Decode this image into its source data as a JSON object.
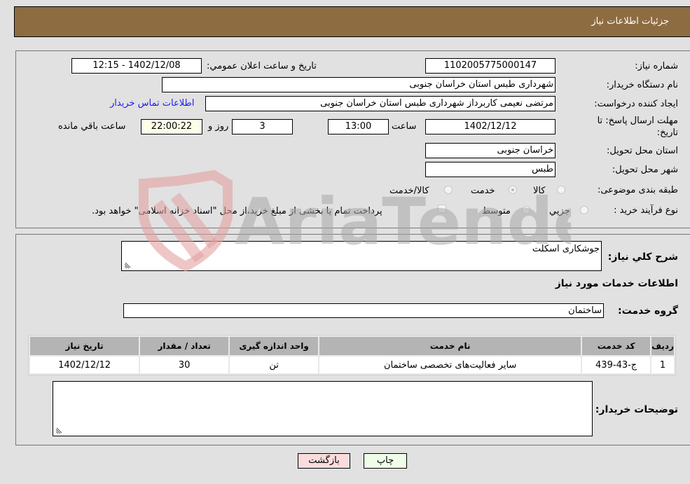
{
  "header": {
    "title": "جزئیات اطلاعات نیاز"
  },
  "details": {
    "need_number_label": "شماره نیاز:",
    "need_number": "1102005775000147",
    "announce_label": "تاریخ و ساعت اعلان عمومي:",
    "announce_value": "1402/12/08 - 12:15",
    "buyer_org_label": "نام دستگاه خریدار:",
    "buyer_org": "شهرداری طبس استان خراسان جنوبی",
    "creator_label": "ایجاد کننده درخواست:",
    "creator": "مرتضی نعیمی کاربرداز شهرداری طبس استان خراسان جنوبی",
    "contact_link": "اطلاعات تماس خریدار",
    "deadline_label_1": "مهلت ارسال پاسخ: تا",
    "deadline_label_2": "تاریخ:",
    "deadline_date": "1402/12/12",
    "time_label": "ساعت",
    "deadline_time": "13:00",
    "days_value": "3",
    "days_label": "روز و",
    "remaining_time": "22:00:22",
    "remaining_label": "ساعت باقي مانده",
    "province_label": "استان محل تحویل:",
    "province": "خراسان جنوبی",
    "city_label": "شهر محل تحویل:",
    "city": "طبس",
    "category_label": "طبقه بندی موضوعی:",
    "category_options": [
      "کالا",
      "خدمت",
      "کالا/خدمت"
    ],
    "category_selected": "خدمت",
    "process_label": "نوع فرآیند خرید :",
    "process_options": [
      "جزيي",
      "متوسط"
    ],
    "treasury_note": "پرداخت تمام یا بخشی از مبلغ خرید،از محل \"اسناد خزانه اسلامی\" خواهد بود."
  },
  "description": {
    "label": "شرح کلي نیاز:",
    "value": "جوشکاری اسکلت"
  },
  "services": {
    "section_title": "اطلاعات خدمات مورد نیاز",
    "group_label": "گروه خدمت:",
    "group_value": "ساختمان",
    "columns": [
      "ردیف",
      "کد خدمت",
      "نام خدمت",
      "واحد اندازه گیری",
      "تعداد / مقدار",
      "تاریخ نیاز"
    ],
    "rows": [
      [
        "1",
        "ج-43-439",
        "سایر فعالیت‌های تخصصی ساختمان",
        "تن",
        "30",
        "1402/12/12"
      ]
    ]
  },
  "buyer_notes": {
    "label": "توضیحات خریدار:",
    "value": ""
  },
  "buttons": {
    "print": "چاپ",
    "back": "بازگشت"
  },
  "watermark": {
    "text": "AriaTender.neT"
  }
}
